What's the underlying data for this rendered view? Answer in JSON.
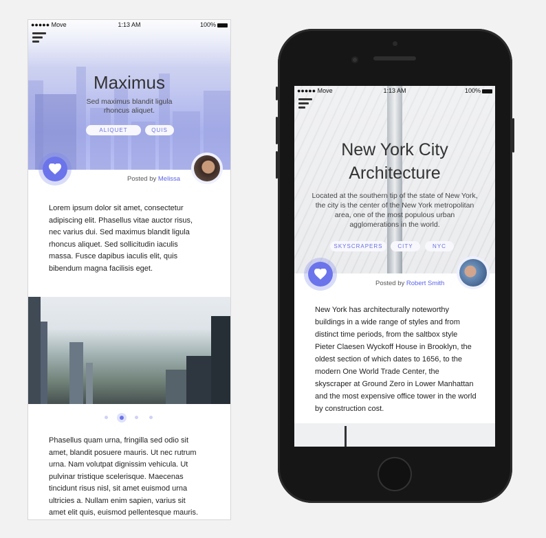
{
  "left": {
    "status": {
      "carrier": "●●●●● Move",
      "time": "1:13 AM",
      "battery": "100%"
    },
    "hero": {
      "title": "Maximus",
      "subtitle": "Sed maximus blandit ligula rhoncus aliquet.",
      "tags": [
        "ALIQUET",
        "QUIS"
      ]
    },
    "posted_prefix": "Posted by",
    "author": "Melissa",
    "body1": "Lorem ipsum dolor sit amet, consectetur adipiscing elit. Phasellus vitae auctor risus, nec varius dui. Sed maximus blandit ligula rhoncus aliquet. Sed sollicitudin iaculis massa. Fusce dapibus iaculis elit, quis bibendum magna facilisis eget.",
    "carousel": {
      "count": 4,
      "active_index": 1
    },
    "body2": "Phasellus quam urna, fringilla sed odio sit amet, blandit posuere mauris. Ut nec rutrum urna. Nam volutpat dignissim vehicula. Ut pulvinar tristique scelerisque. Maecenas tincidunt risus nisl, sit amet euismod urna ultricies a. Nullam enim sapien, varius sit amet elit quis, euismod pellentesque mauris."
  },
  "right": {
    "status": {
      "carrier": "●●●●● Move",
      "time": "1:13 AM",
      "battery": "100%"
    },
    "hero": {
      "title": "New York City Architecture",
      "subtitle": "Located at the southern tip of the state of New York, the city is the center of the New York metropolitan area, one of the most populous urban agglomerations in the world.",
      "tags": [
        "SKYSCRAPERS",
        "CITY",
        "NYC"
      ]
    },
    "posted_prefix": "Posted by",
    "author": "Robert Smith",
    "body": "New York has architecturally noteworthy buildings in a wide range of styles and from distinct time periods, from the saltbox style Pieter Claesen Wyckoff House in Brooklyn, the oldest section of which dates to 1656, to the modern One World Trade Center, the skyscraper at Ground Zero in Lower Manhattan and the most expensive office tower in the world by construction cost."
  },
  "colors": {
    "accent": "#6b74ea",
    "accent_light": "#dfe2fb",
    "link": "#5b64e6"
  },
  "icons": {
    "menu": "hamburger-menu-icon",
    "favorite": "heart-icon",
    "wifi": "wifi-icon",
    "battery": "battery-icon"
  }
}
